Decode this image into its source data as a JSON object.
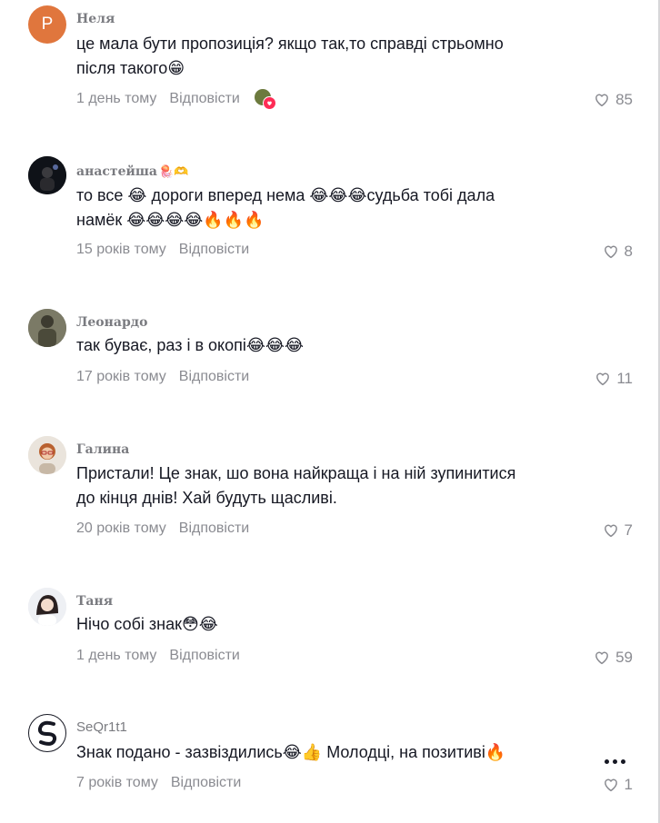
{
  "comments": [
    {
      "avatar_letter": "P",
      "username": "Неля",
      "badge": "",
      "text_line1": "це мала бути пропозиція? якщо так,то справді стрьомно",
      "text_line2": "після такого😁",
      "time": "1 день тому",
      "reply": "Відповісти",
      "likes": "85"
    },
    {
      "username": "анастейша",
      "badge": "🪼🫶",
      "text_line1": "то все 😂 дороги вперед нема 😂😂😂судьба тобі дала",
      "text_line2": "намёк 😂😂😂😂🔥🔥🔥",
      "time": "15 років тому",
      "reply": "Відповісти",
      "likes": "8"
    },
    {
      "username": "Леонардо",
      "badge": "",
      "text_line1": "так буває, раз і в окопі😂😂😂",
      "text_line2": "",
      "time": "17 років тому",
      "reply": "Відповісти",
      "likes": "11"
    },
    {
      "username": "Галина",
      "badge": "",
      "text_line1": "Пристали! Це знак, шо вона найкраща і на ній зупинитися",
      "text_line2": "до кінця днів! Хай будуть щасливі.",
      "time": "20 років тому",
      "reply": "Відповісти",
      "likes": "7"
    },
    {
      "username": "Таня",
      "badge": "",
      "text_line1": "Нічо собі знак😳😂",
      "text_line2": "",
      "time": "1 день тому",
      "reply": "Відповісти",
      "likes": "59"
    },
    {
      "username": "SeQr1t1",
      "badge": "",
      "text_line1": "Знак подано - зазвіздились😂👍 Молодці, на позитиві🔥",
      "text_line2": "",
      "time": "7 років тому",
      "reply": "Відповісти",
      "likes": "1"
    }
  ],
  "colors": {
    "text": "#161823",
    "muted": "#8a8b91",
    "avatar_letter_bg": "#e0763d",
    "heart_badge": "#fe2c55"
  },
  "icons": {
    "like": "heart-outline-icon",
    "more": "more-horizontal-icon",
    "creator_like": "creator-liked-avatar-icon"
  }
}
